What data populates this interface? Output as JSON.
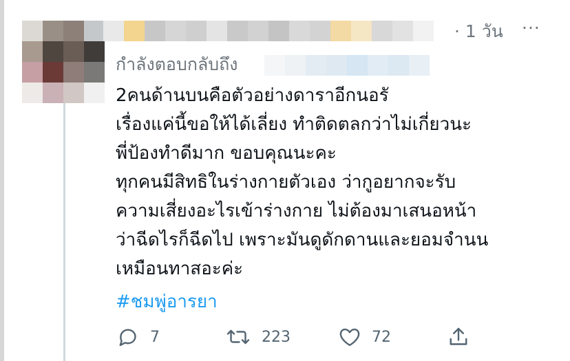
{
  "tweet": {
    "time": "· 1 วัน",
    "more_glyph": "···",
    "reply_label": "กำลังตอบกลับถึง",
    "body_lines": [
      "2คนด้านบนคือตัวอย่างดาราอีกนอรั",
      "เรื่องแค่นี้ขอให้ได้เลี่ยง ทำติดตลกว่าไม่เกี่ยวนะ",
      "พี่ป้องทำดีมาก ขอบคุณนะคะ",
      "ทุกคนมีสิทธิในร่างกายตัวเอง ว่ากูอยากจะรับ",
      "ความเสี่ยงอะไรเข้าร่างกาย ไม่ต้องมาเสนอหน้า",
      "ว่าฉีดไรก็ฉีดไป เพราะมันดูดักดานและยอมจำนน",
      "เหมือนทาสอะค่ะ"
    ],
    "hashtag": "#ชมพู่อารยา"
  },
  "actions": {
    "reply_count": "7",
    "retweet_count": "223",
    "like_count": "72"
  },
  "colors": {
    "text": "#0f1419",
    "muted": "#6e767d",
    "link": "#1d9bf0",
    "icon": "#536471"
  },
  "icons": {
    "reply": "speech-bubble-icon",
    "retweet": "retweet-arrows-icon",
    "like": "heart-icon",
    "share": "share-upload-icon",
    "more": "more-dots-icon"
  }
}
